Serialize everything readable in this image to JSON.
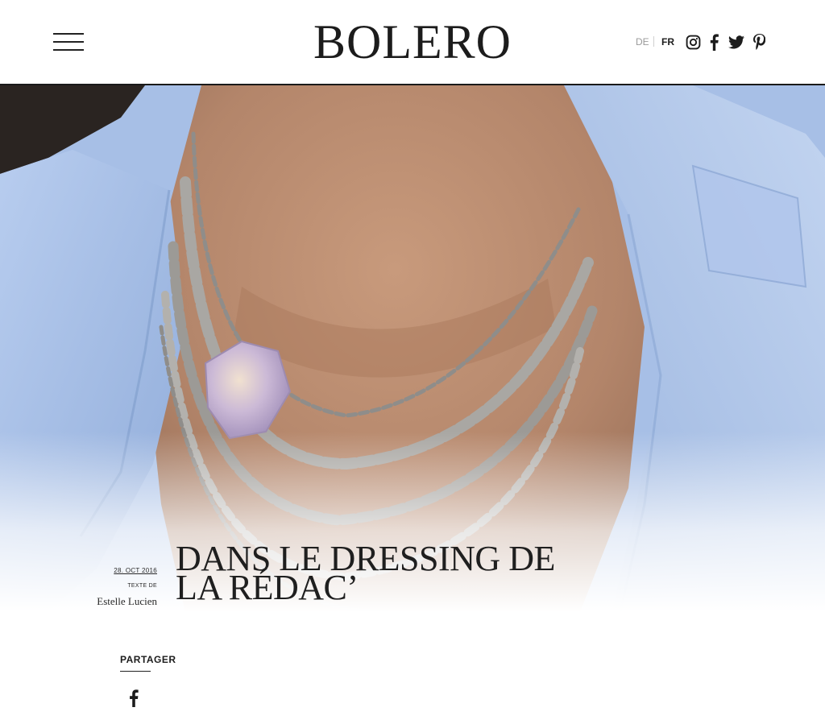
{
  "header": {
    "logo": "BOLERO",
    "languages": [
      "DE",
      "FR"
    ],
    "active_language": "FR",
    "social_icons": [
      "instagram-icon",
      "facebook-icon",
      "twitter-icon",
      "pinterest-icon"
    ]
  },
  "article": {
    "date": "28. OCT 2016",
    "texte_label": "TEXTE DE",
    "author": "Estelle Lucien",
    "title_line1": "DANS LE DRESSING DE",
    "title_line2": "LA RÉDAC’"
  },
  "share": {
    "label": "PARTAGER",
    "icons": [
      "facebook-icon"
    ]
  },
  "colors": {
    "text": "#1c1c1c",
    "shirt_blue": "#a9c1e8",
    "lang_inactive": "#9a9a9a"
  }
}
